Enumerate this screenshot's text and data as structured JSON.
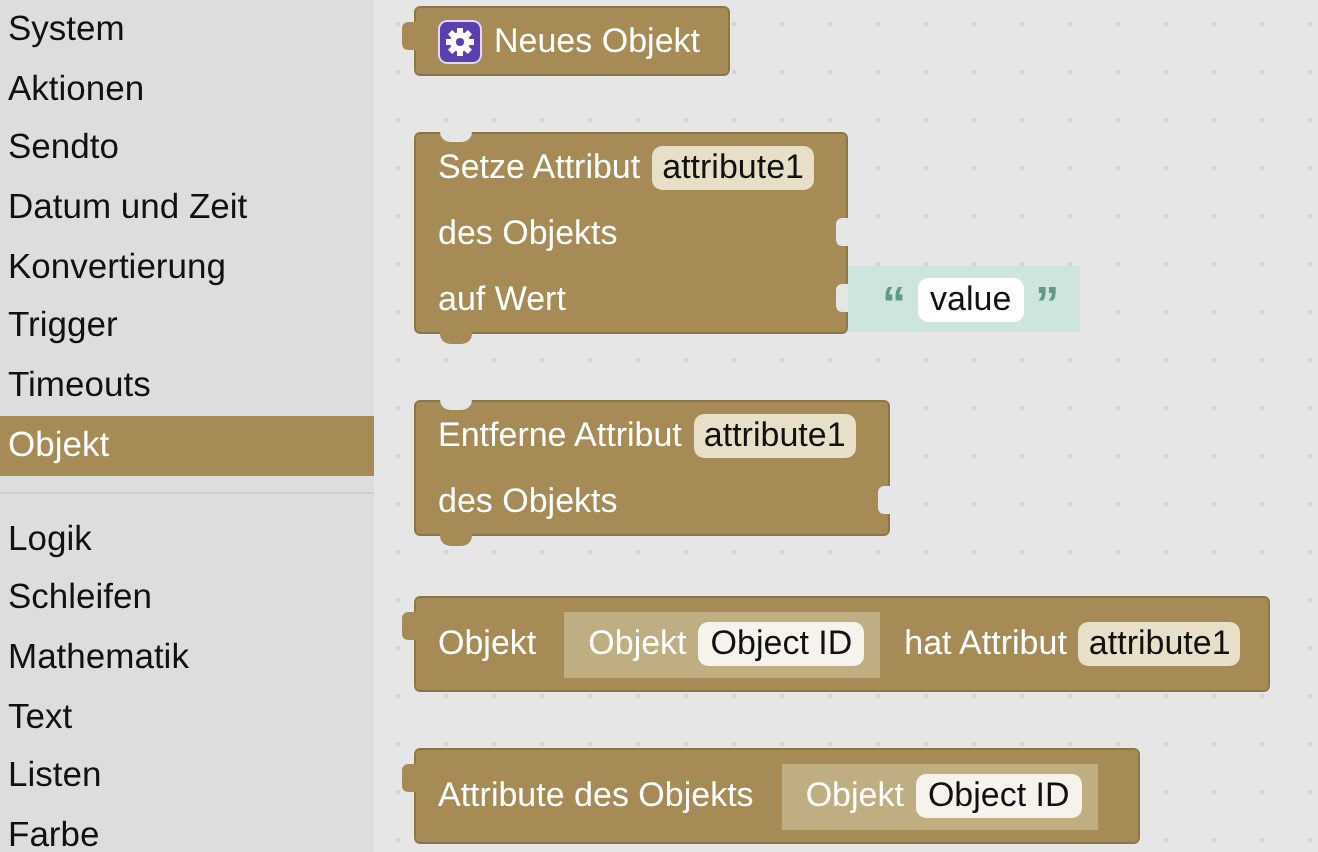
{
  "sidebar": {
    "groups": [
      {
        "items": [
          {
            "label": "System",
            "selected": false
          },
          {
            "label": "Aktionen",
            "selected": false
          },
          {
            "label": "Sendto",
            "selected": false
          },
          {
            "label": "Datum und Zeit",
            "selected": false
          },
          {
            "label": "Konvertierung",
            "selected": false
          },
          {
            "label": "Trigger",
            "selected": false
          },
          {
            "label": "Timeouts",
            "selected": false
          },
          {
            "label": "Objekt",
            "selected": true
          }
        ]
      },
      {
        "items": [
          {
            "label": "Logik",
            "selected": false
          },
          {
            "label": "Schleifen",
            "selected": false
          },
          {
            "label": "Mathematik",
            "selected": false
          },
          {
            "label": "Text",
            "selected": false
          },
          {
            "label": "Listen",
            "selected": false
          },
          {
            "label": "Farbe",
            "selected": false
          }
        ]
      }
    ]
  },
  "blocks": [
    {
      "kind": "value",
      "rows": [
        {
          "parts": [
            {
              "kind": "icon"
            },
            {
              "kind": "label",
              "text": "Neues Objekt"
            }
          ]
        }
      ]
    },
    {
      "kind": "statement",
      "rows": [
        {
          "parts": [
            {
              "kind": "label",
              "text": "Setze Attribut"
            },
            {
              "kind": "field",
              "text": "attribute1"
            }
          ]
        },
        {
          "parts": [
            {
              "kind": "label",
              "text": "des Objekts"
            }
          ],
          "input": {
            "kind": "socket"
          }
        },
        {
          "parts": [
            {
              "kind": "label",
              "text": "auf Wert"
            }
          ],
          "input": {
            "kind": "text",
            "open": "“",
            "value": "value",
            "close": "”"
          }
        }
      ]
    },
    {
      "kind": "statement",
      "rows": [
        {
          "parts": [
            {
              "kind": "label",
              "text": "Entferne Attribut"
            },
            {
              "kind": "field",
              "text": "attribute1"
            }
          ]
        },
        {
          "parts": [
            {
              "kind": "label",
              "text": "des Objekts"
            }
          ],
          "input": {
            "kind": "socket"
          }
        }
      ]
    },
    {
      "kind": "value",
      "rows": [
        {
          "parts": [
            {
              "kind": "label",
              "text": "Objekt"
            },
            {
              "kind": "inline",
              "label": "Objekt",
              "field": "Object ID"
            },
            {
              "kind": "label",
              "text": "hat Attribut"
            },
            {
              "kind": "field",
              "text": "attribute1"
            }
          ]
        }
      ]
    },
    {
      "kind": "value",
      "rows": [
        {
          "parts": [
            {
              "kind": "label",
              "text": "Attribute des Objekts"
            },
            {
              "kind": "inline",
              "label": "Objekt",
              "field": "Object ID"
            }
          ]
        }
      ]
    }
  ]
}
